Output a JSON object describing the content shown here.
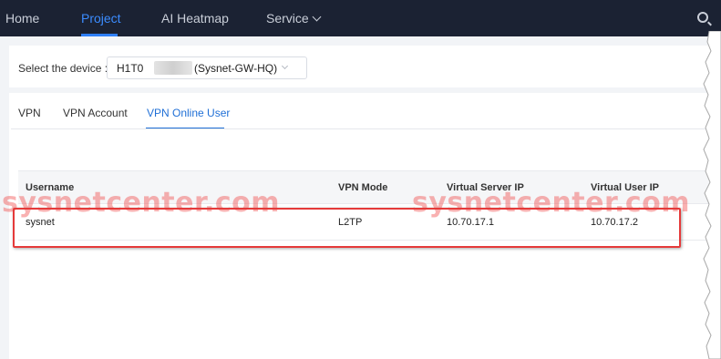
{
  "nav": {
    "items": [
      {
        "label": "Home",
        "active": false
      },
      {
        "label": "Project",
        "active": true
      },
      {
        "label": "AI Heatmap",
        "active": false
      },
      {
        "label": "Service",
        "active": false
      }
    ],
    "search_icon": "search-icon"
  },
  "device": {
    "label": "Select the device :",
    "id_prefix": "H1T0",
    "name": "(Sysnet-GW-HQ)"
  },
  "tabs": [
    {
      "label": "VPN",
      "active": false
    },
    {
      "label": "VPN Account",
      "active": false
    },
    {
      "label": "VPN Online User",
      "active": true
    }
  ],
  "table": {
    "columns": [
      "Username",
      "VPN Mode",
      "Virtual Server IP",
      "Virtual User IP"
    ],
    "rows": [
      {
        "username": "sysnet",
        "vpn_mode": "L2TP",
        "virtual_server_ip": "10.70.17.1",
        "virtual_user_ip": "10.70.17.2"
      }
    ]
  },
  "watermark": "sysnetcenter.com",
  "colors": {
    "nav_bg": "#1b2233",
    "accent": "#1f6fd6",
    "highlight": "#e53a3a",
    "watermark": "#f04646"
  }
}
